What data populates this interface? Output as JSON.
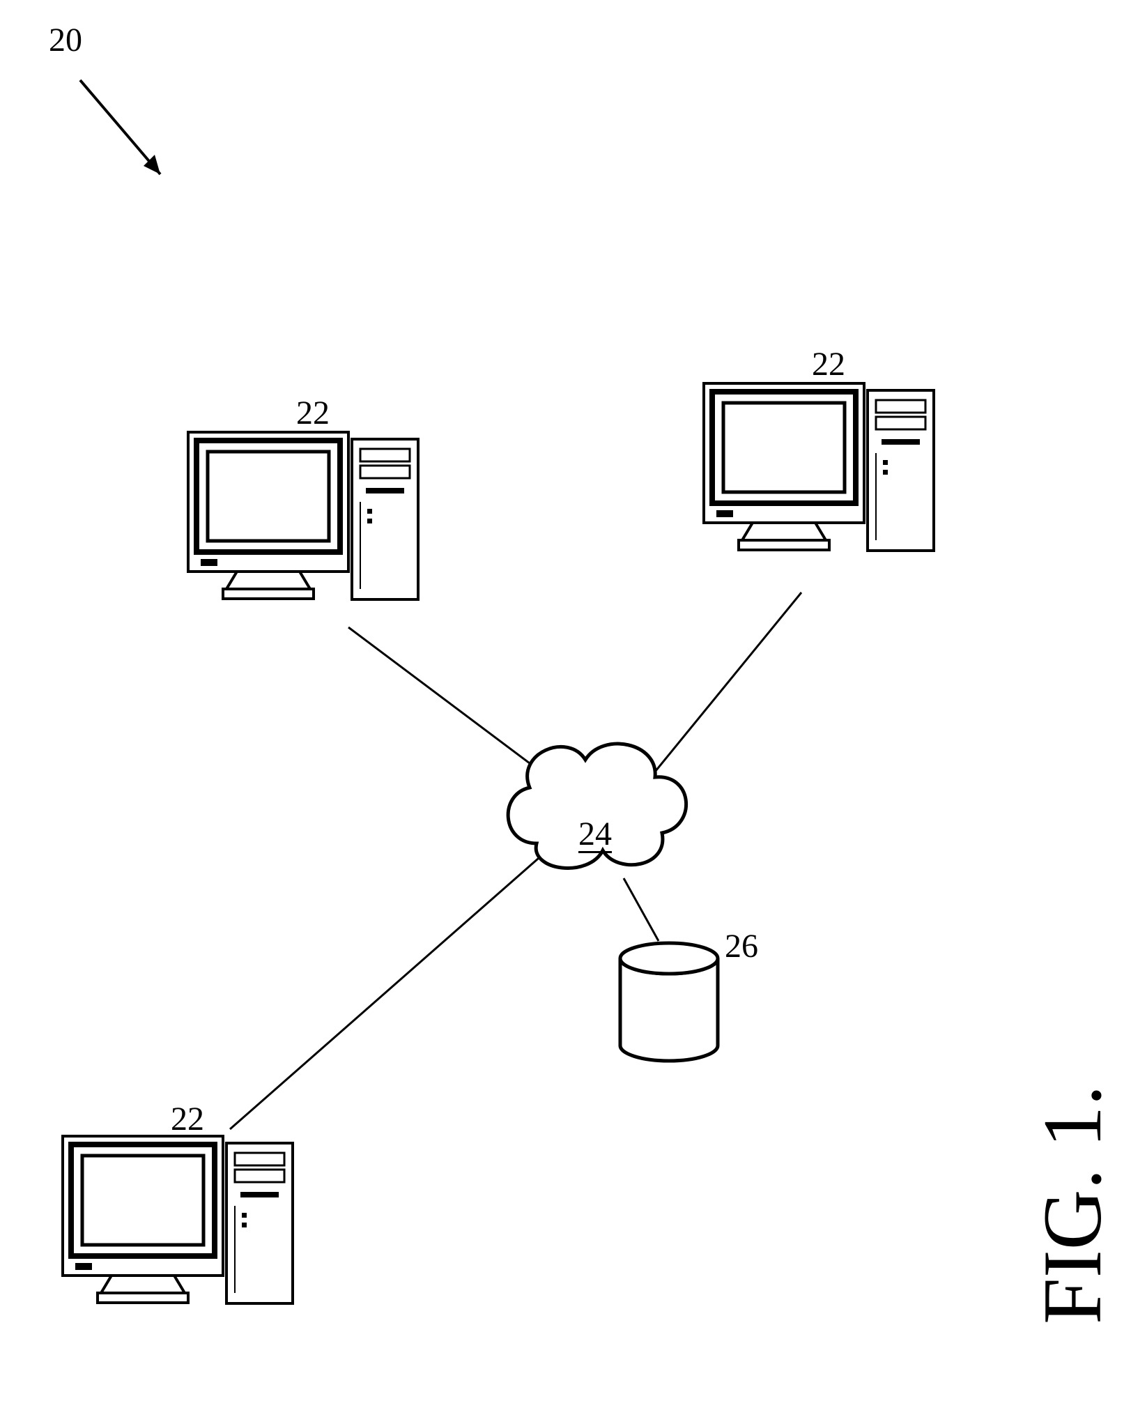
{
  "labels": {
    "system": "20",
    "computer_a": "22",
    "computer_b": "22",
    "computer_c": "22",
    "cloud": "24",
    "database": "26"
  },
  "caption": "FIG. 1."
}
